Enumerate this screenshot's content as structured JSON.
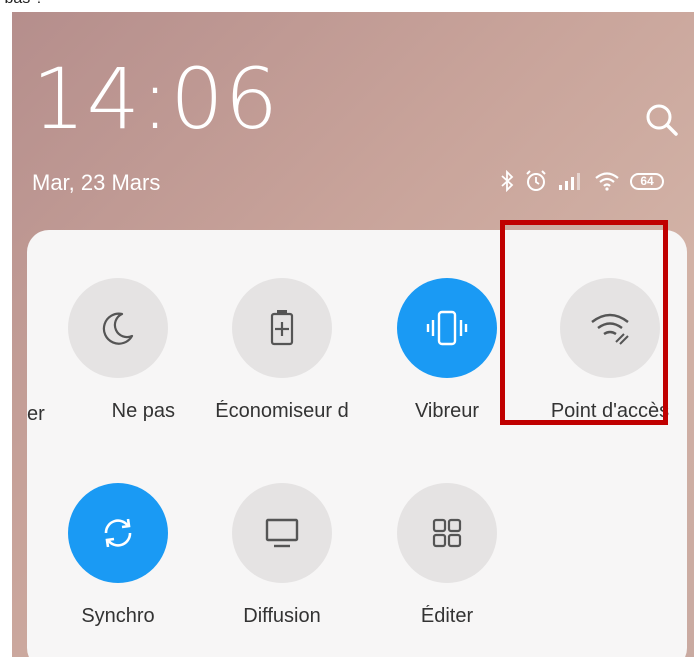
{
  "top_crop_text": "s bas ?",
  "status_bar": {
    "time": "14:06",
    "date": "Mar, 23 Mars",
    "battery_level": "64",
    "icons": [
      "bluetooth-icon",
      "alarm-icon",
      "signal-icon",
      "wifi-icon",
      "battery-icon"
    ]
  },
  "quick_settings": {
    "row1": [
      {
        "label": "er",
        "icon": "partial-tile"
      },
      {
        "label": "Ne pas",
        "icon": "moon-icon",
        "active": false
      },
      {
        "label": "Économiseur d",
        "icon": "battery-saver-icon",
        "active": false
      },
      {
        "label": "Vibreur",
        "icon": "vibrate-icon",
        "active": true
      },
      {
        "label": "Point d'accès",
        "icon": "hotspot-icon",
        "active": false
      }
    ],
    "row2": [
      {
        "label": "Synchro",
        "icon": "sync-icon",
        "active": true
      },
      {
        "label": "Diffusion",
        "icon": "cast-icon",
        "active": false
      },
      {
        "label": "Éditer",
        "icon": "edit-grid-icon",
        "active": false
      }
    ]
  },
  "colors": {
    "active_tile": "#1a9af4",
    "inactive_tile": "#e5e3e3",
    "highlight_box": "#c00000"
  }
}
